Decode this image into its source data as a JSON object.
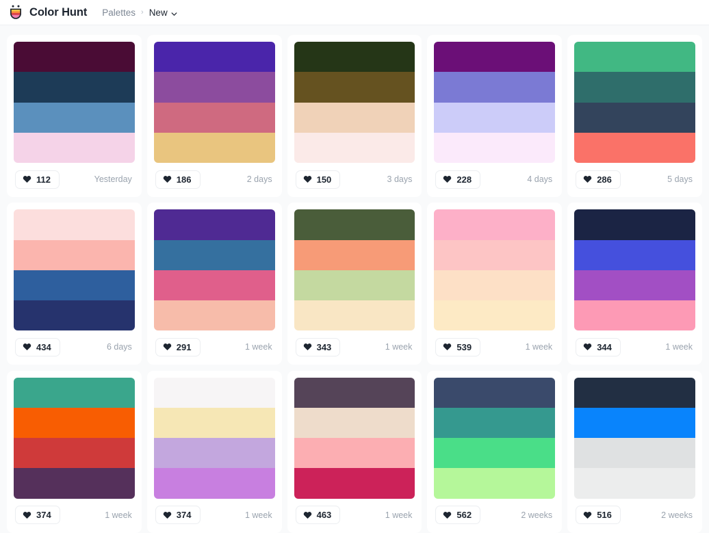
{
  "header": {
    "brand_name": "Color Hunt",
    "logo_icon": "color-hunt-badge-icon",
    "breadcrumb": {
      "parent": "Palettes",
      "separator": "›",
      "current": "New",
      "chevron_icon": "chevron-down-icon"
    }
  },
  "colors": {
    "page_background": "#f9fafb",
    "card_background": "#ffffff",
    "text_primary": "#1d2530",
    "text_muted": "#9aa3ae",
    "border": "#eceef1"
  },
  "palettes": [
    {
      "likes": "112",
      "date": "Yesterday",
      "like_icon": "heart-icon",
      "swatches": [
        "#4a0c35",
        "#1d3b57",
        "#5b90bd",
        "#f5d3e8"
      ]
    },
    {
      "likes": "186",
      "date": "2 days",
      "like_icon": "heart-icon",
      "swatches": [
        "#4a25aa",
        "#8c4c9e",
        "#cf6a80",
        "#e9c57f"
      ]
    },
    {
      "likes": "150",
      "date": "3 days",
      "like_icon": "heart-icon",
      "swatches": [
        "#253617",
        "#655220",
        "#f0d2b8",
        "#fbeae8"
      ]
    },
    {
      "likes": "228",
      "date": "4 days",
      "like_icon": "heart-icon",
      "swatches": [
        "#6b0f77",
        "#7b7ad4",
        "#ccccf9",
        "#fbeafb"
      ]
    },
    {
      "likes": "286",
      "date": "5 days",
      "like_icon": "heart-icon",
      "swatches": [
        "#41b883",
        "#2f6e6b",
        "#33445c",
        "#fa7268"
      ]
    },
    {
      "likes": "434",
      "date": "6 days",
      "like_icon": "heart-icon",
      "swatches": [
        "#fcdedd",
        "#fbb5ae",
        "#2e5f9e",
        "#26336d"
      ]
    },
    {
      "likes": "291",
      "date": "1 week",
      "like_icon": "heart-icon",
      "swatches": [
        "#4f2a93",
        "#35709f",
        "#e05f8b",
        "#f7bcaa"
      ]
    },
    {
      "likes": "343",
      "date": "1 week",
      "like_icon": "heart-icon",
      "swatches": [
        "#4a5d3a",
        "#f79b77",
        "#c4d9a0",
        "#f9e6c4"
      ]
    },
    {
      "likes": "539",
      "date": "1 week",
      "like_icon": "heart-icon",
      "swatches": [
        "#fdb0c8",
        "#fdc5c5",
        "#fde0c6",
        "#fdeac5"
      ]
    },
    {
      "likes": "344",
      "date": "1 week",
      "like_icon": "heart-icon",
      "swatches": [
        "#1b2444",
        "#4550dd",
        "#a24fc4",
        "#fd9ab5"
      ]
    },
    {
      "likes": "374",
      "date": "1 week",
      "like_icon": "heart-icon",
      "swatches": [
        "#3aa68c",
        "#f85d02",
        "#cf3a3a",
        "#55305b"
      ]
    },
    {
      "likes": "374",
      "date": "1 week",
      "like_icon": "heart-icon",
      "swatches": [
        "#f7f5f6",
        "#f6e7b5",
        "#c3a7de",
        "#c87fe0"
      ]
    },
    {
      "likes": "463",
      "date": "1 week",
      "like_icon": "heart-icon",
      "swatches": [
        "#554458",
        "#eedccb",
        "#fcaeb2",
        "#cc2259"
      ]
    },
    {
      "likes": "562",
      "date": "2 weeks",
      "like_icon": "heart-icon",
      "swatches": [
        "#3a4a6b",
        "#35998f",
        "#4ade88",
        "#b5f79a"
      ]
    },
    {
      "likes": "516",
      "date": "2 weeks",
      "like_icon": "heart-icon",
      "swatches": [
        "#222f43",
        "#0984fc",
        "#dfe1e2",
        "#eceded"
      ]
    }
  ]
}
